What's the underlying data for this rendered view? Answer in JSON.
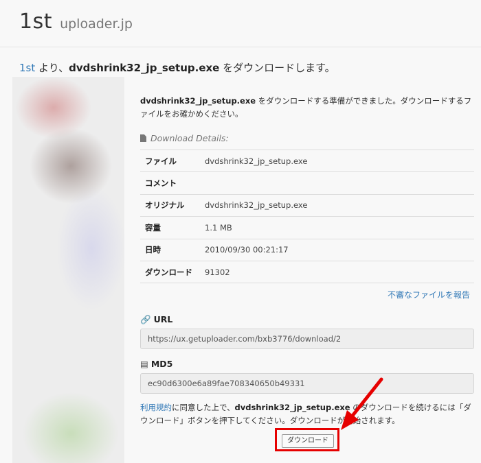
{
  "header": {
    "title": "1st",
    "subtitle": "uploader.jp"
  },
  "heading": {
    "link": "1st",
    "mid": " より、",
    "filename": "dvdshrink32_jp_setup.exe",
    "tail": " をダウンロードします。"
  },
  "intro": {
    "filename": "dvdshrink32_jp_setup.exe",
    "text": " をダウンロードする準備ができました。ダウンロードするファイルをお確かめください。"
  },
  "details": {
    "title": "Download Details:",
    "rows": [
      {
        "label": "ファイル",
        "value": "dvdshrink32_jp_setup.exe"
      },
      {
        "label": "コメント",
        "value": ""
      },
      {
        "label": "オリジナル",
        "value": "dvdshrink32_jp_setup.exe"
      },
      {
        "label": "容量",
        "value": "1.1 MB"
      },
      {
        "label": "日時",
        "value": "2010/09/30 00:21:17"
      },
      {
        "label": "ダウンロード",
        "value": "91302"
      }
    ]
  },
  "report_link": "不審なファイルを報告",
  "url": {
    "label": "URL",
    "value": "https://ux.getuploader.com/bxb3776/download/2"
  },
  "md5": {
    "label": "MD5",
    "value": "ec90d6300e6a89fae708340650b49331"
  },
  "agree": {
    "terms_link": "利用規約",
    "part1": "に同意した上で、",
    "filename": "dvdshrink32_jp_setup.exe",
    "part2": " のダウンロードを続けるには「ダウンロード」ボタンを押下してください。ダウンロードが開始されます。"
  },
  "download_button": "ダウンロード",
  "colors": {
    "link": "#337ab7",
    "highlight": "#e60000"
  }
}
